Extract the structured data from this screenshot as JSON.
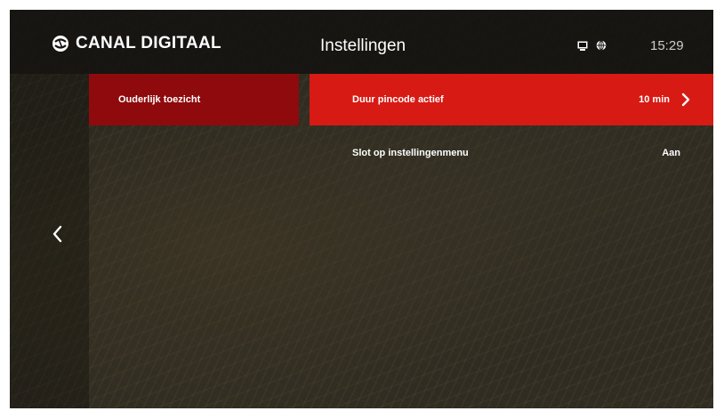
{
  "header": {
    "brand": "CANAL DIGITAAL",
    "title": "Instellingen",
    "time": "15:29",
    "status_icons": [
      "screen-icon",
      "globe-icon"
    ]
  },
  "menu": {
    "items": [
      {
        "label": "Ouderlijk toezicht",
        "selected": true
      }
    ]
  },
  "settings": {
    "rows": [
      {
        "label": "Duur pincode actief",
        "value": "10 min",
        "focused": true
      },
      {
        "label": "Slot op instellingenmenu",
        "value": "Aan",
        "focused": false
      }
    ]
  },
  "colors": {
    "menu_selected": "#8e0a0c",
    "row_focused": "#d71a14",
    "topbar": "#141210"
  },
  "icons": {
    "brand": "canal-digitaal-logo-icon",
    "back": "chevron-left-icon",
    "row_arrow": "chevron-right-icon"
  }
}
